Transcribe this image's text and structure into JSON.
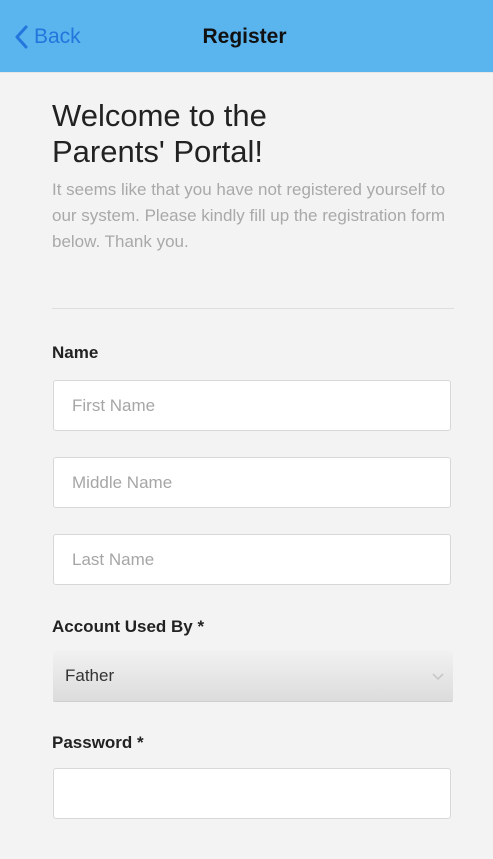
{
  "header": {
    "back_label": "Back",
    "title": "Register"
  },
  "intro": {
    "title_line1": "Welcome to the",
    "title_line2": "Parents' Portal!",
    "description": "It seems like that you have not registered yourself to our system. Please kindly fill up the registration form below. Thank you."
  },
  "form": {
    "name_label": "Name",
    "first_name_placeholder": "First Name",
    "middle_name_placeholder": "Middle Name",
    "last_name_placeholder": "Last Name",
    "account_used_by_label": "Account Used By *",
    "account_used_by_value": "Father",
    "password_label": "Password *"
  },
  "colors": {
    "header_bg": "#5ab4ee",
    "back_link": "#2277dd"
  },
  "icons": {
    "back": "chevron-left-icon",
    "select": "chevron-down-icon"
  }
}
